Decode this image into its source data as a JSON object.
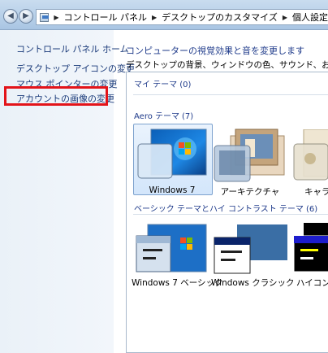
{
  "window": {
    "back_glyph": "◀",
    "forward_glyph": "▶",
    "breadcrumb": [
      "コントロール パネル",
      "デスクトップのカスタマイズ",
      "個人設定"
    ]
  },
  "sidebar": {
    "title": "コントロール パネル ホーム",
    "items": [
      {
        "label": "デスクトップ アイコンの変更"
      },
      {
        "label": "マウス ポインターの変更"
      },
      {
        "label": "アカウントの画像の変更"
      }
    ]
  },
  "main": {
    "heading": "コンピューターの視覚効果と音を変更します",
    "description": "デスクトップの背景、ウィンドウの色、サウンド、およびスクリー",
    "sections": {
      "my_themes": {
        "label": "マイ テーマ",
        "count": "(0)"
      },
      "aero": {
        "label": "Aero テーマ",
        "count": "(7)"
      },
      "basic": {
        "label": "ベーシック テーマとハイ コントラスト テーマ",
        "count": "(6)"
      }
    },
    "aero_themes": [
      {
        "label": "Windows 7"
      },
      {
        "label": "アーキテクチャ"
      },
      {
        "label": "キャラ"
      }
    ],
    "basic_themes": [
      {
        "label": "Windows 7 ベーシック"
      },
      {
        "label": "Windows クラシック"
      },
      {
        "label": "ハイコント"
      }
    ]
  },
  "colors": {
    "link": "#1b3b7a",
    "highlight_border": "#e3141a",
    "selection": "#d3e6fb"
  }
}
